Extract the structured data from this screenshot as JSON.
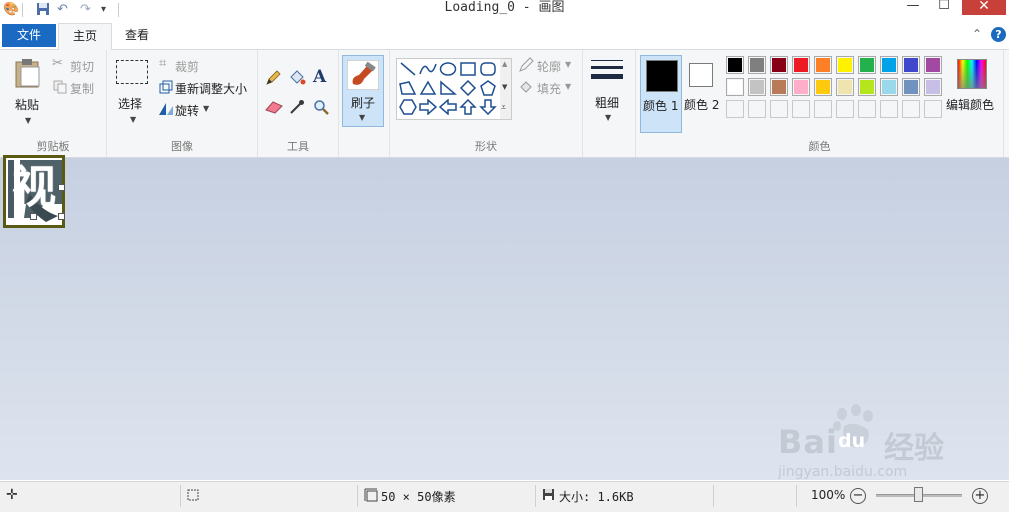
{
  "titlebar": {
    "title": "Loading_0 - 画图",
    "minimize": "—",
    "maximize": "☐",
    "close": "✕"
  },
  "tabs": {
    "file": "文件",
    "home": "主页",
    "view": "查看"
  },
  "ribbon": {
    "clipboard": {
      "group": "剪贴板",
      "paste": "粘贴",
      "cut": "剪切",
      "copy": "复制"
    },
    "image": {
      "group": "图像",
      "select": "选择",
      "crop": "裁剪",
      "resize": "重新调整大小",
      "rotate": "旋转"
    },
    "tools": {
      "group": "工具",
      "text_tool": "A"
    },
    "brush": {
      "label": "刷子"
    },
    "shapes": {
      "group": "形状",
      "outline": "轮廓",
      "fill": "填充"
    },
    "size": {
      "label": "粗细"
    },
    "colors": {
      "group": "颜色",
      "color1": "颜色 1",
      "color2": "颜色 2",
      "edit": "编辑颜色",
      "color1_value": "#000000",
      "color2_value": "#ffffff",
      "palette_row1": [
        "#000000",
        "#7f7f7f",
        "#880015",
        "#ed1c24",
        "#ff7f27",
        "#fff200",
        "#22b14c",
        "#00a2e8",
        "#3f48cc",
        "#a349a4"
      ],
      "palette_row2": [
        "#ffffff",
        "#c3c3c3",
        "#b97a57",
        "#ffaec9",
        "#ffc90e",
        "#efe4b0",
        "#b5e61d",
        "#99d9ea",
        "#7092be",
        "#c8bfe7"
      ]
    }
  },
  "canvas": {
    "glyph": "视"
  },
  "status": {
    "dimensions": "50 × 50像素",
    "file_size": "大小: 1.6KB",
    "zoom": "100%"
  },
  "watermark": {
    "brand": "Bai",
    "brand_suffix": "经验",
    "url": "jingyan.baidu.com"
  }
}
